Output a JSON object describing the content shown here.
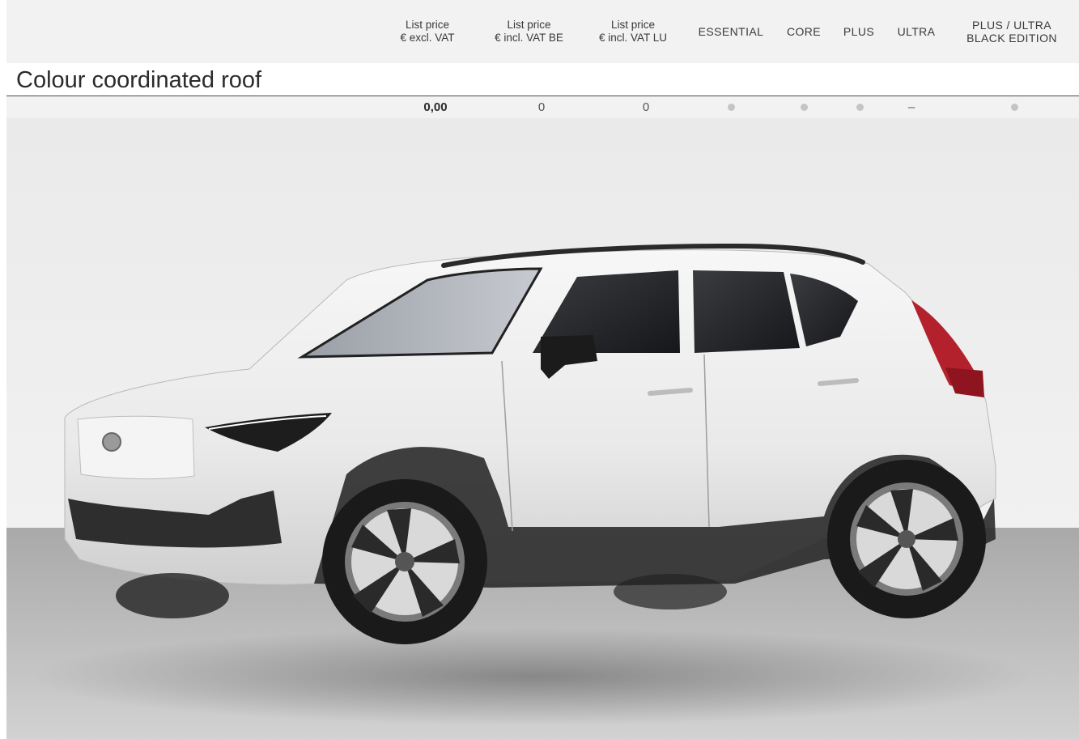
{
  "header": {
    "columns": [
      {
        "line1": "List price",
        "line2": "€ excl. VAT"
      },
      {
        "line1": "List price",
        "line2": "€ incl. VAT BE"
      },
      {
        "line1": "List price",
        "line2": "€ incl. VAT LU"
      },
      {
        "line1": "ESSENTIAL",
        "line2": ""
      },
      {
        "line1": "CORE",
        "line2": ""
      },
      {
        "line1": "PLUS",
        "line2": ""
      },
      {
        "line1": "ULTRA",
        "line2": ""
      },
      {
        "line1": "PLUS / ULTRA",
        "line2": "BLACK EDITION"
      }
    ]
  },
  "section": {
    "title": "Colour coordinated roof"
  },
  "row": {
    "price_excl_vat": "0,00",
    "price_incl_vat_be": "0",
    "price_incl_vat_lu": "0",
    "essential": "standard",
    "core": "standard",
    "plus": "standard",
    "ultra": "–",
    "plus_ultra_black_edition": "standard"
  },
  "colors": {
    "band": "#f2f2f2",
    "dot": "#c4c4c4",
    "text": "#2b2b2b"
  }
}
